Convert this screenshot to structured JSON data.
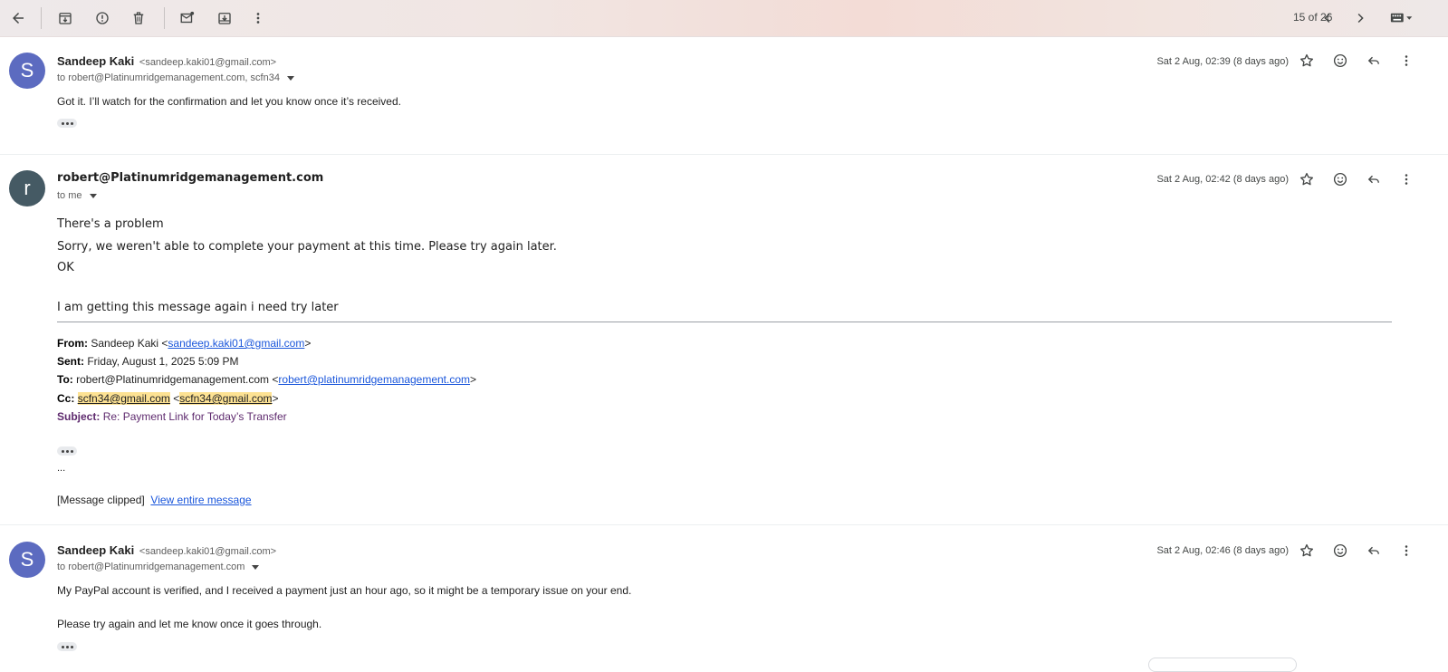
{
  "toolbar": {
    "count": "15 of 26",
    "icons": [
      "back-arrow-icon",
      "archive-icon",
      "report-spam-icon",
      "delete-icon",
      "mark-unread-icon",
      "move-to-icon",
      "more-vert-icon",
      "older-chevron-icon",
      "newer-chevron-icon",
      "keyboard-icon"
    ]
  },
  "messages": [
    {
      "avatar": "S",
      "avatar_color": "#5c6bc0",
      "sender": "Sandeep Kaki",
      "sender_email": "<sandeep.kaki01@gmail.com>",
      "to": "to robert@Platinumridgemanagement.com, scfn34",
      "date": "Sat 2 Aug, 02:39 (8 days ago)",
      "body": [
        "Got it. I’ll watch for the confirmation and let you know once it’s received."
      ]
    },
    {
      "avatar": "r",
      "avatar_color": "#455a64",
      "sender": "robert@Platinumridgemanagement.com",
      "to": "to me",
      "date": "Sat 2 Aug, 02:42 (8 days ago)",
      "body": [
        "There's a problem",
        "Sorry, we weren't able to complete your payment at this time. Please try again later.",
        "OK",
        "I am getting this message again i need try later"
      ],
      "quoted": {
        "from_label": "From:",
        "from_name": "Sandeep Kaki <",
        "from_email": "sandeep.kaki01@gmail.com",
        "from_close": ">",
        "sent_label": "Sent:",
        "sent_value": "Friday, August 1, 2025 5:09 PM",
        "to_label": "To:",
        "to_name": "robert@Platinumridgemanagement.com <",
        "to_email": "robert@platinumridgemanagement.com",
        "to_close": ">",
        "cc_label": "Cc:",
        "cc_email1": "scfn34@gmail.com",
        "cc_open": "<",
        "cc_email2": "scfn34@gmail.com",
        "cc_close": ">",
        "subject_label": "Subject:",
        "subject_value": "Re: Payment Link for Today’s Transfer"
      },
      "ellipsis": "...",
      "clipped": "[Message clipped]",
      "view_entire": "View entire message"
    },
    {
      "avatar": "S",
      "avatar_color": "#5c6bc0",
      "sender": "Sandeep Kaki",
      "sender_email": "<sandeep.kaki01@gmail.com>",
      "to": "to robert@Platinumridgemanagement.com",
      "date": "Sat 2 Aug, 02:46 (8 days ago)",
      "body": [
        "My PayPal account is verified, and I received a payment just an hour ago, so it might be a temporary issue on your end.",
        "Please try again and let me know once it goes through."
      ]
    }
  ]
}
